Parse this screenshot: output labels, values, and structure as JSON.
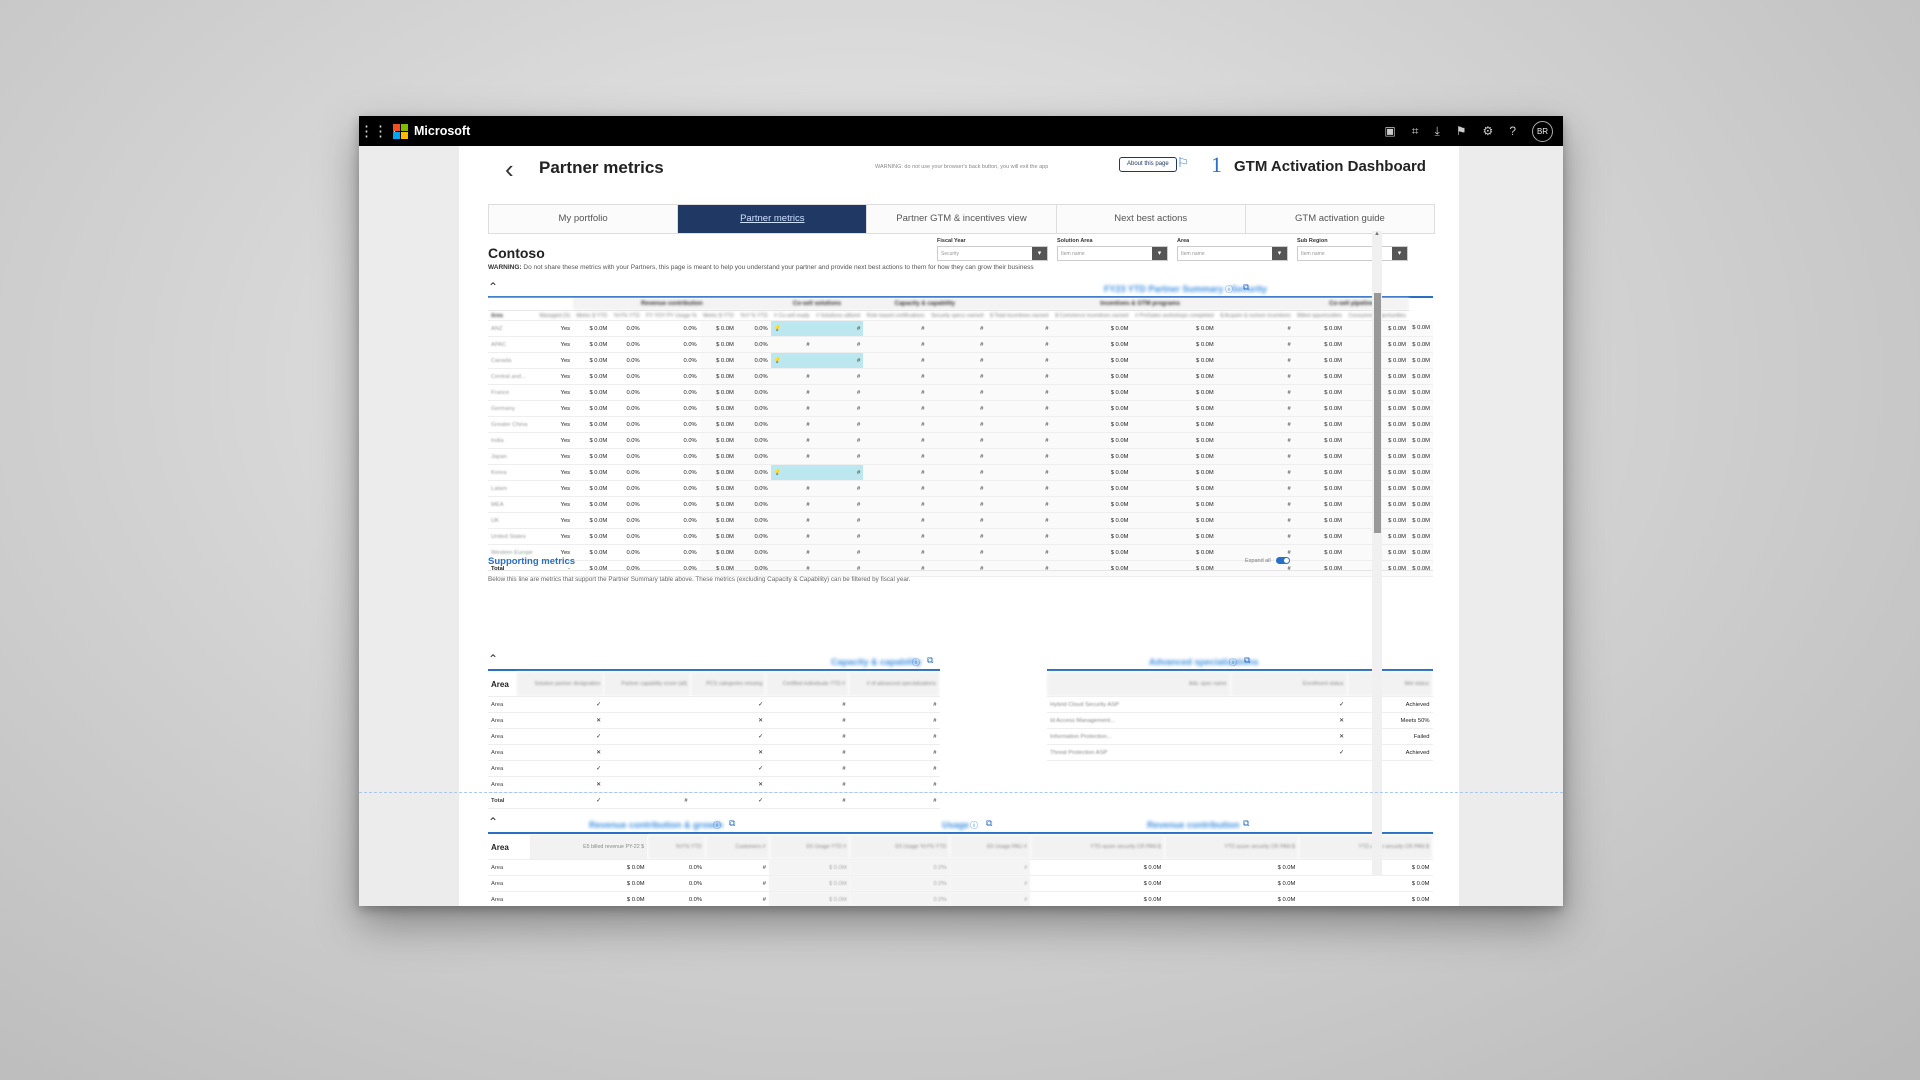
{
  "topbar": {
    "brand": "Microsoft",
    "avatar": "BR",
    "icons": [
      "waffle-icon",
      "teams-icon",
      "fullscreen-icon",
      "download-icon",
      "flag-icon",
      "gear-icon",
      "help-icon"
    ]
  },
  "header": {
    "back": "‹",
    "title": "Partner metrics",
    "warning": "WARNING: do not use your browser's back button, you will exit the app",
    "about": "About this page",
    "number": "1",
    "dashboard_title": "GTM Activation Dashboard"
  },
  "tabs": [
    "My portfolio",
    "Partner metrics",
    "Partner GTM & incentives view",
    "Next best actions",
    "GTM activation guide"
  ],
  "entity": "Contoso",
  "filters": [
    {
      "label": "Fiscal Year",
      "value": "Security"
    },
    {
      "label": "Solution Area",
      "value": "Item name"
    },
    {
      "label": "Area",
      "value": "Item name"
    },
    {
      "label": "Sub Region",
      "value": "Item name"
    }
  ],
  "warning": {
    "bold": "WARNING:",
    "text": "Do not share these metrics with your Partners, this page is meant to help you understand your partner and provide next best actions to them for how they can grow their business"
  },
  "summary": {
    "title": "FY23 YTD Partner Summary - Security",
    "groups": [
      "Revenue contribution",
      "Co-sell solutions",
      "Capacity & capability",
      "Incentives & GTM programs",
      "Co-sell pipeline"
    ],
    "headers": [
      "Area",
      "Managed (S)",
      "Metric $ YTD",
      "YoY% YTD",
      "FY YOY PY Usage %",
      "Metric $ YTD",
      "YoY % YTD",
      "# Co-sell ready",
      "# Solutions utilized",
      "Role based certifications",
      "Security specs earned",
      "$ Total incentives earned",
      "$ Commerce incentives earned",
      "# PreSales workshops completed",
      "$ Acquire & nurture incentives",
      "Billed opportunities",
      "Consumed opportunities"
    ],
    "rows": [
      {
        "area": "ANZ",
        "cs": true
      },
      {
        "area": "APAC",
        "cs": false
      },
      {
        "area": "Canada",
        "cs": true
      },
      {
        "area": "Central and...",
        "cs": false
      },
      {
        "area": "France",
        "cs": false
      },
      {
        "area": "Germany",
        "cs": false
      },
      {
        "area": "Greater China",
        "cs": false
      },
      {
        "area": "India",
        "cs": false
      },
      {
        "area": "Japan",
        "cs": false
      },
      {
        "area": "Korea",
        "cs": true
      },
      {
        "area": "Latam",
        "cs": false
      },
      {
        "area": "MEA",
        "cs": false
      },
      {
        "area": "UK",
        "cs": false
      },
      {
        "area": "United States",
        "cs": false
      },
      {
        "area": "Western Europe",
        "cs": false
      }
    ],
    "cell": {
      "yes": "Yes",
      "money": "$ 0.0M",
      "pct": "0.0%",
      "hash": "#",
      "dash": "-"
    },
    "total_label": "Total"
  },
  "supporting": {
    "title": "Supporting metrics",
    "desc": "Below this line are metrics that support the Partner Summary table above. These metrics (excluding Capacity & Capability) can be filtered by fiscal year.",
    "expand_label": "Expand all"
  },
  "capacity": {
    "title": "Capacity & capability",
    "headers": [
      "Area",
      "Solution partner designation",
      "Partner capability score (all)",
      "PCS categories missing",
      "Certified individuals YTD #",
      "# of advanced specializations"
    ],
    "rows": [
      {
        "area": "Area",
        "sp": "✓",
        "pcs": "✓",
        "cert": "#",
        "adv": "#"
      },
      {
        "area": "Area",
        "sp": "✕",
        "pcs": "✕",
        "cert": "#",
        "adv": "#"
      },
      {
        "area": "Area",
        "sp": "✓",
        "pcs": "✓",
        "cert": "#",
        "adv": "#"
      },
      {
        "area": "Area",
        "sp": "✕",
        "pcs": "✕",
        "cert": "#",
        "adv": "#"
      },
      {
        "area": "Area",
        "sp": "✓",
        "pcs": "✓",
        "cert": "#",
        "adv": "#"
      },
      {
        "area": "Area",
        "sp": "✕",
        "pcs": "✕",
        "cert": "#",
        "adv": "#"
      },
      {
        "area": "Total",
        "sp": "✓",
        "score": "#",
        "pcs": "✓",
        "cert": "#",
        "adv": "#"
      }
    ]
  },
  "advanced": {
    "title": "Advanced specializations",
    "headers": [
      "Adv. spec name",
      "Enrollment status",
      "Met status"
    ],
    "rows": [
      {
        "name": "Hybrid Cloud Security ASP",
        "enroll": "✓",
        "status": "Achieved"
      },
      {
        "name": "Id Access Management...",
        "enroll": "✕",
        "status": "Meets 50%"
      },
      {
        "name": "Information Protection...",
        "enroll": "✕",
        "status": "Failed"
      },
      {
        "name": "Threat Protection ASP",
        "enroll": "✓",
        "status": "Achieved"
      }
    ]
  },
  "revenue": {
    "title": "Revenue contribution & growth",
    "usage_title": "Usage",
    "rc_title": "Revenue contribution",
    "headers": [
      "Area",
      "E5 billed revenue PY-22 $",
      "YoY% YTD",
      "Customers #",
      "E5 Usage YTD #",
      "E5 Usage YoY% YTD",
      "E5 Usage PAU #",
      "YTD azure security CR PAN $",
      "YTD azure security CR PAN $",
      "YTD azure security CR PAN $"
    ],
    "rows": [
      {
        "area": "Area",
        "money": "$ 0.0M",
        "pct": "0.0%",
        "hash": "#"
      },
      {
        "area": "Area",
        "money": "$ 0.0M",
        "pct": "0.0%",
        "hash": "#"
      },
      {
        "area": "Area",
        "money": "$ 0.0M",
        "pct": "0.0%",
        "hash": "#"
      }
    ]
  },
  "colors": {
    "accent": "#2a6fc4",
    "active_tab": "#1f3864",
    "cosell": "#bde7ef"
  }
}
